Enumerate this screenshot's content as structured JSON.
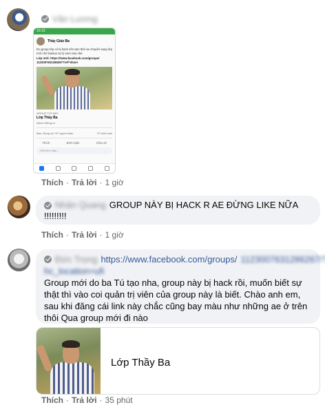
{
  "comments": [
    {
      "author": "Văn Lương",
      "attachment": {
        "status_text": "10:13",
        "post_author": "Thầy Giáo Ba",
        "post_text": "Do group tớp có bị hack nên tạm thời ae chuyển sang lớp mới chờ bantus sử lý xem nào nhé.",
        "post_link_label": "Lớp mới: https://www.facebook.com/groups/",
        "post_link_id": "1123007631286267?ref=share",
        "preview_meta": "GROUP TỚI ĐÂY",
        "preview_title": "Lớp Thầy Ba",
        "preview_subtitle": "Nhóm Riêng tư",
        "reactions": "Bạn, Đông và 747 người khác",
        "comment_count": "97 bình luận",
        "action_like": "Thích",
        "action_comment": "Bình luận",
        "action_share": "Chia sẻ",
        "comment_placeholder": "Viết bình luận..."
      },
      "like": "Thích",
      "reply": "Trả lời",
      "time": "1 giờ"
    },
    {
      "author": "Nhân Quang",
      "text_line1": "GROUP NÀY BỊ HACK R AE ĐỪNG LIKE NỮA",
      "text_line2": "!!!!!!!!!",
      "like": "Thích",
      "reply": "Trả lời",
      "time": "1 giờ"
    },
    {
      "author": "Đức Trọng",
      "link": "https://www.facebook.com/groups/",
      "link_blurred": "1123007631286267/?",
      "link_blurred2": "hc_location=ufi",
      "body": [
        "Group mới do ba Tú tạo nha, group này bị hack rồi, muốn biết sự",
        "thật thì vào coi quản trị viên của group này là biết. Chào anh em,",
        "sau khi đăng cái link này chắc cũng bay màu như những ae ở trên",
        "thôi      Qua group mới đi nào"
      ],
      "preview_title": "Lớp Thầy Ba",
      "like": "Thích",
      "reply": "Trả lời",
      "time": "35 phút"
    }
  ],
  "separator": "·"
}
